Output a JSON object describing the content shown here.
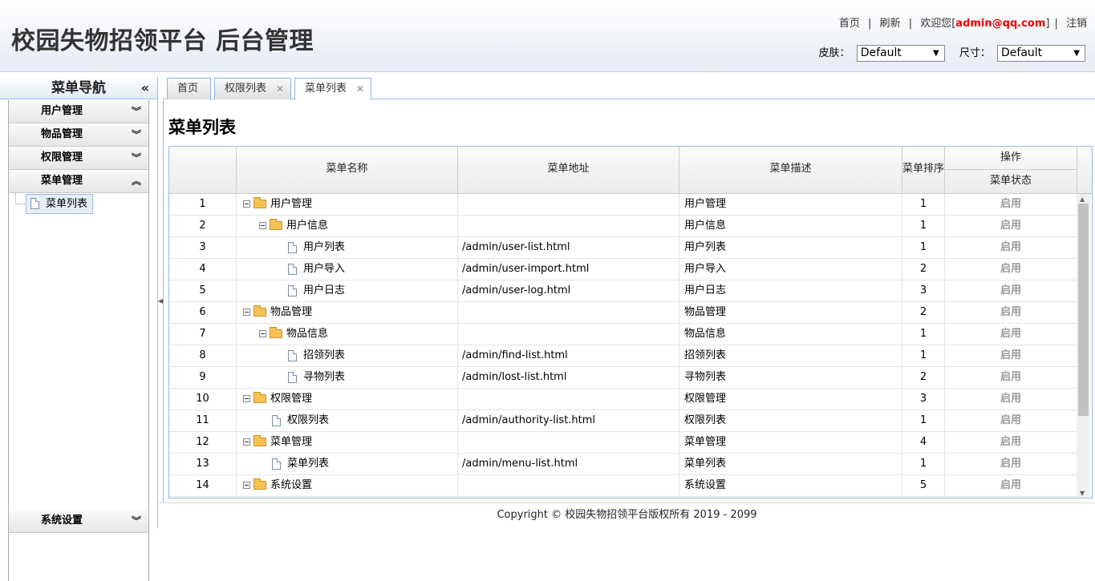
{
  "header": {
    "title": "校园失物招领平台 后台管理",
    "links": {
      "home": "首页",
      "refresh": "刷新",
      "welcome_prefix": "欢迎您[",
      "user": "admin@qq.com",
      "welcome_suffix": "]",
      "logout": "注销",
      "sep": "|"
    },
    "skin_label": "皮肤：",
    "skin_value": "Default",
    "size_label": "尺寸：",
    "size_value": "Default"
  },
  "nav": {
    "title": "菜单导航",
    "collapse": "«",
    "sections": [
      {
        "label": "用户管理",
        "icon": "double-chevron-down-icon"
      },
      {
        "label": "物品管理",
        "icon": "double-chevron-down-icon"
      },
      {
        "label": "权限管理",
        "icon": "double-chevron-down-icon"
      },
      {
        "label": "菜单管理",
        "icon": "double-chevron-up-icon"
      }
    ],
    "active_item": "菜单列表",
    "bottom_section": "系统设置"
  },
  "tabs": [
    {
      "label": "首页",
      "closable": false
    },
    {
      "label": "权限列表",
      "closable": true
    },
    {
      "label": "菜单列表",
      "closable": true,
      "active": true
    }
  ],
  "page": {
    "heading": "菜单列表"
  },
  "table": {
    "headers": {
      "name": "菜单名称",
      "url": "菜单地址",
      "desc": "菜单描述",
      "order": "菜单排序",
      "action": "操作",
      "status": "菜单状态"
    },
    "rows": [
      {
        "num": "1",
        "name": "用户管理",
        "level": 0,
        "type": "folder",
        "url": "",
        "desc": "用户管理",
        "order": "1",
        "status": "启用"
      },
      {
        "num": "2",
        "name": "用户信息",
        "level": 1,
        "type": "folder",
        "url": "",
        "desc": "用户信息",
        "order": "1",
        "status": "启用"
      },
      {
        "num": "3",
        "name": "用户列表",
        "level": 2,
        "type": "file",
        "url": "/admin/user-list.html",
        "desc": "用户列表",
        "order": "1",
        "status": "启用"
      },
      {
        "num": "4",
        "name": "用户导入",
        "level": 2,
        "type": "file",
        "url": "/admin/user-import.html",
        "desc": "用户导入",
        "order": "2",
        "status": "启用"
      },
      {
        "num": "5",
        "name": "用户日志",
        "level": 2,
        "type": "file",
        "url": "/admin/user-log.html",
        "desc": "用户日志",
        "order": "3",
        "status": "启用"
      },
      {
        "num": "6",
        "name": "物品管理",
        "level": 0,
        "type": "folder",
        "url": "",
        "desc": "物品管理",
        "order": "2",
        "status": "启用"
      },
      {
        "num": "7",
        "name": "物品信息",
        "level": 1,
        "type": "folder",
        "url": "",
        "desc": "物品信息",
        "order": "1",
        "status": "启用"
      },
      {
        "num": "8",
        "name": "招领列表",
        "level": 2,
        "type": "file",
        "url": "/admin/find-list.html",
        "desc": "招领列表",
        "order": "1",
        "status": "启用"
      },
      {
        "num": "9",
        "name": "寻物列表",
        "level": 2,
        "type": "file",
        "url": "/admin/lost-list.html",
        "desc": "寻物列表",
        "order": "2",
        "status": "启用"
      },
      {
        "num": "10",
        "name": "权限管理",
        "level": 0,
        "type": "folder",
        "url": "",
        "desc": "权限管理",
        "order": "3",
        "status": "启用"
      },
      {
        "num": "11",
        "name": "权限列表",
        "level": 1,
        "type": "file",
        "url": "/admin/authority-list.html",
        "desc": "权限列表",
        "order": "1",
        "status": "启用"
      },
      {
        "num": "12",
        "name": "菜单管理",
        "level": 0,
        "type": "folder",
        "url": "",
        "desc": "菜单管理",
        "order": "4",
        "status": "启用"
      },
      {
        "num": "13",
        "name": "菜单列表",
        "level": 1,
        "type": "file",
        "url": "/admin/menu-list.html",
        "desc": "菜单列表",
        "order": "1",
        "status": "启用"
      },
      {
        "num": "14",
        "name": "系统设置",
        "level": 0,
        "type": "folder",
        "url": "",
        "desc": "系统设置",
        "order": "5",
        "status": "启用"
      }
    ]
  },
  "footer": {
    "text": "Copyright © 校园失物招领平台版权所有  2019 - 2099"
  }
}
